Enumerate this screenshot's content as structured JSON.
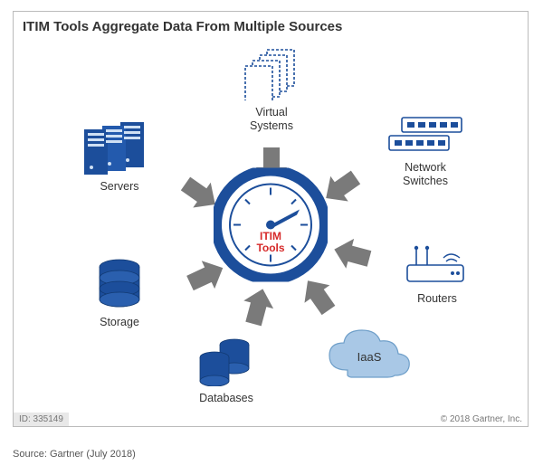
{
  "title": "ITIM Tools Aggregate Data From Multiple Sources",
  "center": {
    "line1": "ITIM",
    "line2": "Tools"
  },
  "nodes": {
    "virtual": {
      "l1": "Virtual",
      "l2": "Systems"
    },
    "switches": {
      "l1": "Network",
      "l2": "Switches"
    },
    "routers": {
      "l1": "Routers"
    },
    "iaas": {
      "l1": "IaaS"
    },
    "databases": {
      "l1": "Databases"
    },
    "storage": {
      "l1": "Storage"
    },
    "servers": {
      "l1": "Servers"
    }
  },
  "id_badge": "ID: 335149",
  "copyright": "© 2018 Gartner, Inc.",
  "source": "Source: Gartner (July 2018)",
  "colors": {
    "blue": "#1c4e9b",
    "grey": "#7a7a7a",
    "red": "#d62a2a",
    "cloud": "#a9c8e6"
  }
}
